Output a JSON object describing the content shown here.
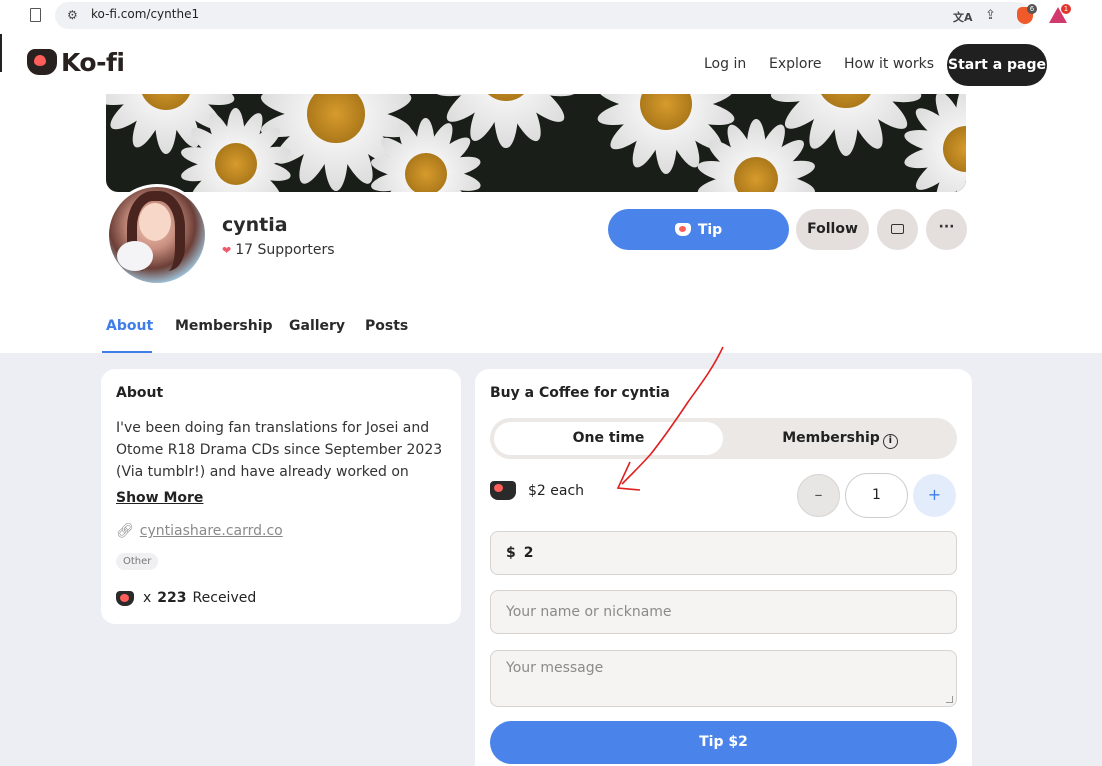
{
  "browser": {
    "url": "ko-fi.com/cynthe1",
    "brave_badge": "6",
    "rewards_badge": "1"
  },
  "header": {
    "logo_text": "Ko-fi",
    "nav": {
      "login": "Log in",
      "explore": "Explore",
      "how_it_works": "How it works",
      "start_page": "Start a page"
    }
  },
  "profile": {
    "name": "cyntia",
    "supporters": "17 Supporters",
    "tip_label": "Tip",
    "follow_label": "Follow",
    "more_label": "···"
  },
  "tabs": [
    "About",
    "Membership",
    "Gallery",
    "Posts"
  ],
  "about": {
    "title": "About",
    "text": "I've been doing fan translations for Josei and Otome R18 Drama CDs since September 2023 (Via tumblr!) and have already worked on over...",
    "show_more": "Show More",
    "link": "cyntiashare.carrd.co",
    "tag": "Other",
    "received_prefix": "x",
    "received_count": "223",
    "received_suffix": "Received"
  },
  "coffee": {
    "title": "Buy a Coffee for cyntia",
    "toggle_one_time": "One time",
    "toggle_membership": "Membership",
    "price": "$2 each",
    "quantity": "1",
    "minus": "–",
    "plus": "+",
    "currency": "$",
    "amount": "2",
    "name_placeholder": "Your name or nickname",
    "message_placeholder": "Your message",
    "submit": "Tip $2"
  },
  "colors": {
    "accent": "#4a84ea",
    "kofi_red": "#ff5e5b",
    "page_bg": "#eceef4",
    "annotation": "#e02020"
  },
  "icons": [
    "bookmark-icon",
    "site-settings-icon",
    "translate-icon",
    "share-icon",
    "brave-shield-icon",
    "brave-rewards-icon",
    "kofi-cup-icon",
    "heart-icon",
    "mail-icon",
    "link-icon",
    "info-icon"
  ]
}
